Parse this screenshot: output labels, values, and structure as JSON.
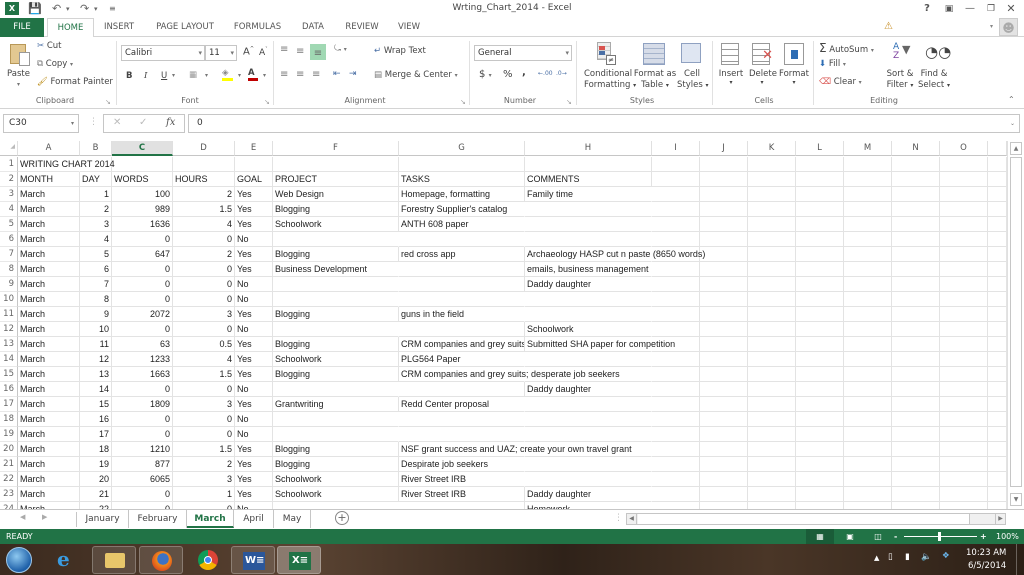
{
  "window": {
    "title": "Wrting_Chart_2014 - Excel",
    "controls": [
      "?",
      "ribbon-display",
      "minimize",
      "restore",
      "close"
    ]
  },
  "quick_access": {
    "app_icon": "excel-icon",
    "items": [
      "save-icon",
      "undo-icon",
      "redo-icon",
      "customize-icon"
    ]
  },
  "tabs": [
    {
      "label": "FILE"
    },
    {
      "label": "HOME",
      "active": true
    },
    {
      "label": "INSERT"
    },
    {
      "label": "PAGE LAYOUT"
    },
    {
      "label": "FORMULAS"
    },
    {
      "label": "DATA"
    },
    {
      "label": "REVIEW"
    },
    {
      "label": "VIEW"
    }
  ],
  "ribbon": {
    "clipboard": {
      "label": "Clipboard",
      "paste": "Paste",
      "cut": "Cut",
      "copy": "Copy",
      "format_painter": "Format Painter"
    },
    "font": {
      "label": "Font",
      "font_name": "Calibri",
      "font_size": "11",
      "bold": "B",
      "italic": "I",
      "underline": "U",
      "grow": "A",
      "shrink": "A",
      "fill_color": "#ffff00",
      "font_color": "#c00000"
    },
    "alignment": {
      "label": "Alignment",
      "wrap_text": "Wrap Text",
      "merge_center": "Merge & Center"
    },
    "number": {
      "label": "Number",
      "format": "General",
      "currency": "$",
      "percent": "%",
      "comma": ",",
      "inc_decimal": ".00",
      "dec_decimal": ".0"
    },
    "styles": {
      "label": "Styles",
      "conditional_formatting": [
        "Conditional",
        "Formatting"
      ],
      "format_as_table": [
        "Format as",
        "Table"
      ],
      "cell_styles": [
        "Cell",
        "Styles"
      ]
    },
    "cells": {
      "label": "Cells",
      "insert": "Insert",
      "delete": "Delete",
      "format": "Format"
    },
    "editing": {
      "label": "Editing",
      "autosum": "AutoSum",
      "fill": "Fill",
      "clear": "Clear",
      "sort_filter": [
        "Sort &",
        "Filter"
      ],
      "find_select": [
        "Find &",
        "Select"
      ]
    }
  },
  "formula_bar": {
    "name_box": "C30",
    "fx": "fx",
    "value": "0"
  },
  "columns": [
    "A",
    "B",
    "C",
    "D",
    "E",
    "F",
    "G",
    "H",
    "I",
    "J",
    "K",
    "L",
    "M",
    "N",
    "O"
  ],
  "selected_column": "C",
  "sheet": {
    "title": "WRITING CHART 2014",
    "headers": [
      "MONTH",
      "DAY",
      "WORDS",
      "HOURS",
      "GOAL",
      "PROJECT",
      "TASKS",
      "COMMENTS"
    ],
    "rows": [
      [
        "March",
        "1",
        "100",
        "2",
        "Yes",
        "Web Design",
        "Homepage, formatting",
        "Family time"
      ],
      [
        "March",
        "2",
        "989",
        "1.5",
        "Yes",
        "Blogging",
        "Forestry Supplier's catalog",
        ""
      ],
      [
        "March",
        "3",
        "1636",
        "4",
        "Yes",
        "Schoolwork",
        "ANTH 608 paper",
        ""
      ],
      [
        "March",
        "4",
        "0",
        "0",
        "No",
        "",
        "",
        ""
      ],
      [
        "March",
        "5",
        "647",
        "2",
        "Yes",
        "Blogging",
        "red cross app",
        "Archaeology HASP cut n paste (8650 words)"
      ],
      [
        "March",
        "6",
        "0",
        "0",
        "Yes",
        "Business Development",
        "",
        "emails, business management"
      ],
      [
        "March",
        "7",
        "0",
        "0",
        "No",
        "",
        "",
        "Daddy daughter"
      ],
      [
        "March",
        "8",
        "0",
        "0",
        "No",
        "",
        "",
        ""
      ],
      [
        "March",
        "9",
        "2072",
        "3",
        "Yes",
        "Blogging",
        "guns in the field",
        ""
      ],
      [
        "March",
        "10",
        "0",
        "0",
        "No",
        "",
        "",
        "Schoolwork"
      ],
      [
        "March",
        "11",
        "63",
        "0.5",
        "Yes",
        "Blogging",
        "CRM companies and grey suits",
        "Submitted SHA paper for competition"
      ],
      [
        "March",
        "12",
        "1233",
        "4",
        "Yes",
        "Schoolwork",
        "PLG564 Paper",
        ""
      ],
      [
        "March",
        "13",
        "1663",
        "1.5",
        "Yes",
        "Blogging",
        "CRM companies and grey suits; desperate job seekers",
        ""
      ],
      [
        "March",
        "14",
        "0",
        "0",
        "No",
        "",
        "",
        "Daddy daughter"
      ],
      [
        "March",
        "15",
        "1809",
        "3",
        "Yes",
        "Grantwriting",
        "Redd Center proposal",
        ""
      ],
      [
        "March",
        "16",
        "0",
        "0",
        "No",
        "",
        "",
        ""
      ],
      [
        "March",
        "17",
        "0",
        "0",
        "No",
        "",
        "",
        ""
      ],
      [
        "March",
        "18",
        "1210",
        "1.5",
        "Yes",
        "Blogging",
        "NSF grant success and UAZ; create your own travel grant",
        ""
      ],
      [
        "March",
        "19",
        "877",
        "2",
        "Yes",
        "Blogging",
        "Despirate job seekers",
        ""
      ],
      [
        "March",
        "20",
        "6065",
        "3",
        "Yes",
        "Schoolwork",
        "River Street IRB",
        ""
      ],
      [
        "March",
        "21",
        "0",
        "1",
        "Yes",
        "Schoolwork",
        "River Street IRB",
        "Daddy daughter"
      ],
      [
        "March",
        "22",
        "0",
        "0",
        "No",
        "",
        "",
        "Homework"
      ]
    ]
  },
  "sheet_tabs": [
    {
      "label": "January"
    },
    {
      "label": "February"
    },
    {
      "label": "March",
      "active": true
    },
    {
      "label": "April"
    },
    {
      "label": "May"
    }
  ],
  "status": {
    "text": "READY",
    "zoom": "100%",
    "zoom_level": 1.0,
    "views": [
      "normal-view",
      "page-layout-view",
      "page-break-view"
    ]
  },
  "taskbar": {
    "apps": [
      "start-button",
      "internet-explorer",
      "file-explorer",
      "firefox",
      "chrome",
      "word",
      "excel"
    ],
    "time": "10:23 AM",
    "date": "6/5/2014"
  },
  "colors": {
    "accent": "#217346",
    "selected_fill": "#a0d8b3"
  }
}
